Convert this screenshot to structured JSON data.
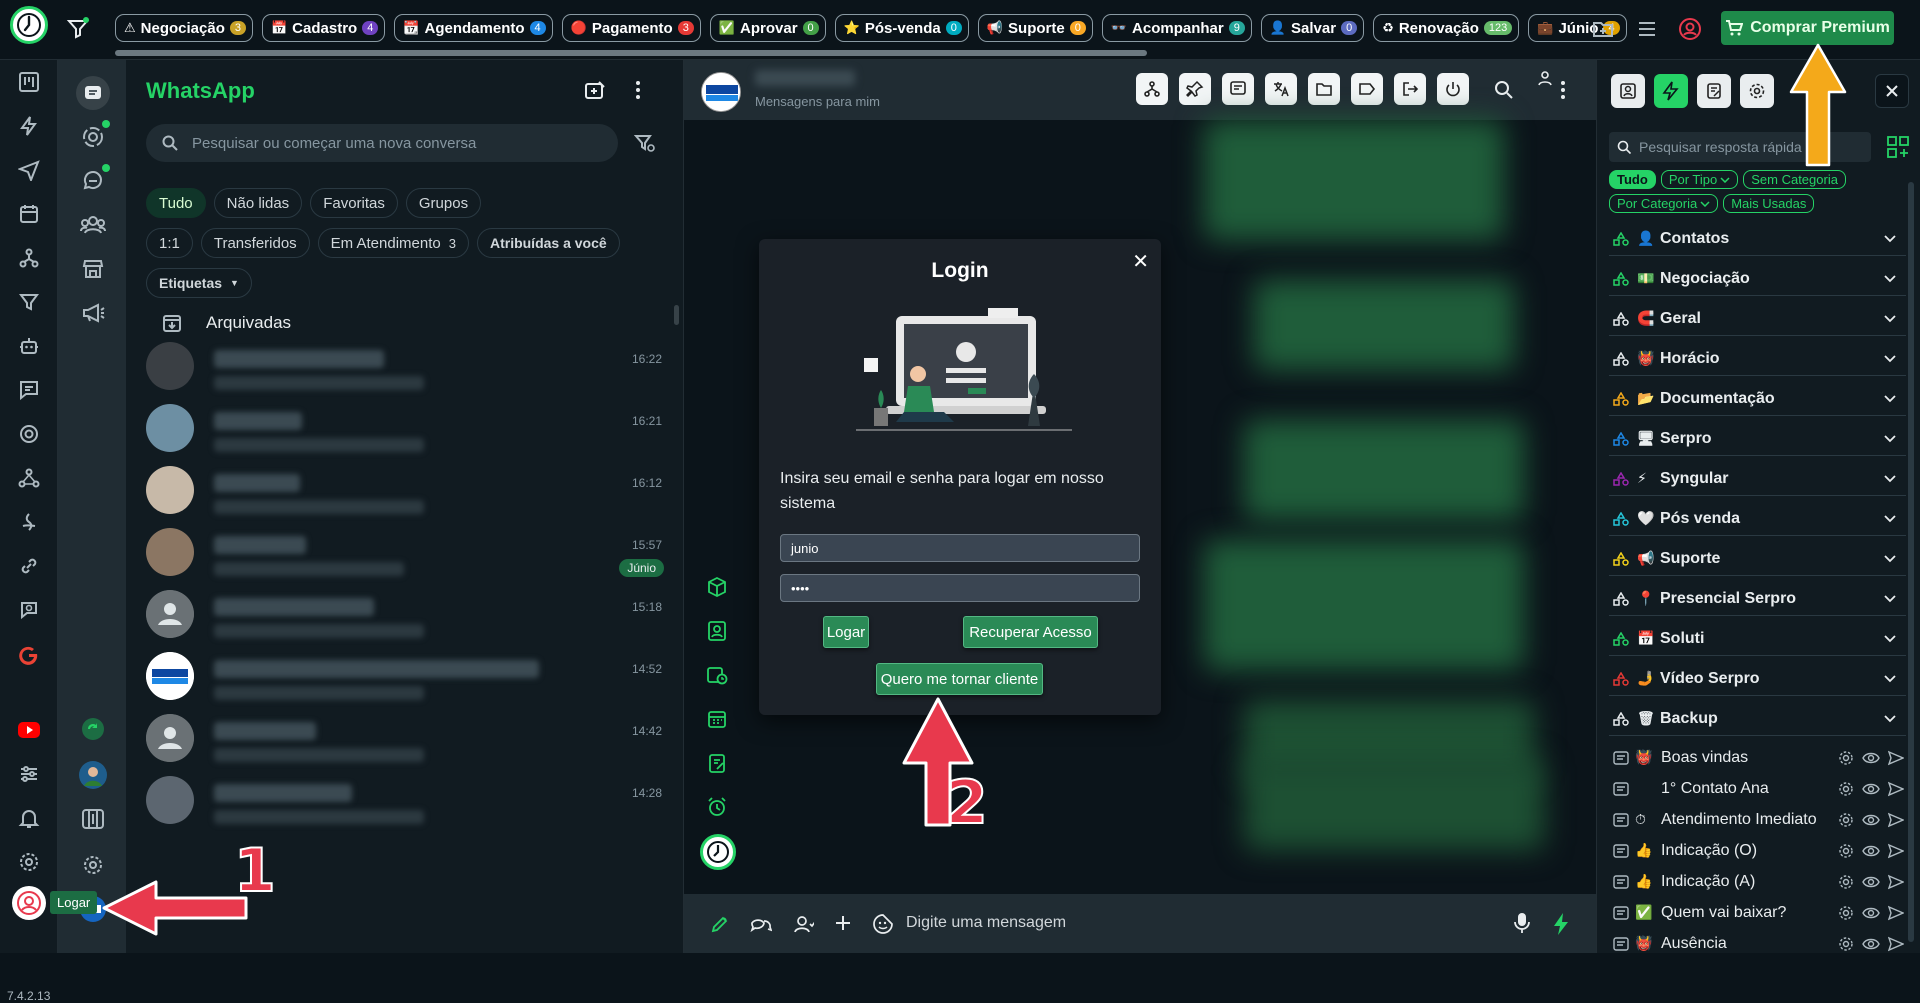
{
  "topbar": {
    "tabs": [
      {
        "icon": "⚠",
        "label": "Negociação",
        "count": "3",
        "count_color": "#c9a227"
      },
      {
        "icon": "📅",
        "label": "Cadastro",
        "count": "4",
        "count_color": "#6f42c1"
      },
      {
        "icon": "📆",
        "label": "Agendamento",
        "count": "4",
        "count_color": "#1e88e5"
      },
      {
        "icon": "🔴",
        "label": "Pagamento",
        "count": "3",
        "count_color": "#e53935"
      },
      {
        "icon": "✅",
        "label": "Aprovar",
        "count": "0",
        "count_color": "#43a047"
      },
      {
        "icon": "⭐",
        "label": "Pós-venda",
        "count": "0",
        "count_color": "#00acc1"
      },
      {
        "icon": "📢",
        "label": "Suporte",
        "count": "0",
        "count_color": "#f9a825"
      },
      {
        "icon": "👓",
        "label": "Acompanhar",
        "count": "9",
        "count_color": "#26a69a"
      },
      {
        "icon": "👤",
        "label": "Salvar",
        "count": "0",
        "count_color": "#5c6bc0"
      },
      {
        "icon": "♻",
        "label": "Renovação",
        "count": "123",
        "count_color": "#66bb6a"
      },
      {
        "icon": "💼",
        "label": "Júnio",
        "count": "4",
        "count_color": "#e0a100"
      }
    ],
    "premium_label": "Comprar Premium"
  },
  "rail": {
    "version": "7.4.2.13",
    "tooltip": "Logar"
  },
  "chatlist": {
    "title": "WhatsApp",
    "search_placeholder": "Pesquisar ou começar uma nova conversa",
    "filters_row1": [
      "Tudo",
      "Não lidas",
      "Favoritas",
      "Grupos"
    ],
    "filters_row2": [
      "1:1",
      "Transferidos",
      "Em Atendimento",
      "Atribuídas a você"
    ],
    "em_atendimento_count": "3",
    "etiquetas_label": "Etiquetas",
    "archived_label": "Arquivadas",
    "chats": [
      {
        "time": "16:22",
        "badge": ""
      },
      {
        "time": "16:21",
        "badge": ""
      },
      {
        "time": "16:12",
        "badge": ""
      },
      {
        "time": "15:57",
        "badge": "Júnio"
      },
      {
        "time": "15:18",
        "badge": ""
      },
      {
        "time": "14:52",
        "badge": ""
      },
      {
        "time": "14:42",
        "badge": ""
      },
      {
        "time": "14:28",
        "badge": ""
      }
    ]
  },
  "chat": {
    "header_subtitle": "Mensagens para mim",
    "compose_placeholder": "Digite uma mensagem"
  },
  "login_modal": {
    "title": "Login",
    "description": "Insira seu email e senha para logar em nosso sistema",
    "email_value": "junio",
    "password_value": "••••",
    "login_button": "Logar",
    "recover_button": "Recuperar Acesso",
    "become_client_button": "Quero me tornar cliente"
  },
  "rightpanel": {
    "search_placeholder": "Pesquisar resposta rápida",
    "chips_row1": [
      "Tudo",
      "Por Tipo",
      "Sem Categoria"
    ],
    "chips_row2": [
      "Por Categoria",
      "Mais Usadas"
    ],
    "categories": [
      {
        "emoji": "👤",
        "name": "Contatos",
        "color": "#25d366"
      },
      {
        "emoji": "💵",
        "name": "Negociação",
        "color": "#25d366"
      },
      {
        "emoji": "🧲",
        "name": "Geral",
        "color": "#e9edef"
      },
      {
        "emoji": "👹",
        "name": "Horácio",
        "color": "#e9edef"
      },
      {
        "emoji": "📂",
        "name": "Documentação",
        "color": "#f4a91a"
      },
      {
        "emoji": "🖥",
        "name": "Serpro",
        "color": "#1e88e5"
      },
      {
        "emoji": "⚡",
        "name": "Syngular",
        "color": "#9c27b0"
      },
      {
        "emoji": "🤍",
        "name": "Pós venda",
        "color": "#26c6da"
      },
      {
        "emoji": "📢",
        "name": "Suporte",
        "color": "#f4d21a"
      },
      {
        "emoji": "📍",
        "name": "Presencial Serpro",
        "color": "#e9edef"
      },
      {
        "emoji": "📅",
        "name": "Soluti",
        "color": "#25d366"
      },
      {
        "emoji": "🤳",
        "name": "Vídeo Serpro",
        "color": "#e53935"
      },
      {
        "emoji": "🗑",
        "name": "Backup",
        "color": "#e9edef"
      }
    ],
    "replies": [
      {
        "emoji": "👹",
        "name": "Boas vindas"
      },
      {
        "emoji": "",
        "name": "1° Contato Ana"
      },
      {
        "emoji": "⏱",
        "name": "Atendimento Imediato"
      },
      {
        "emoji": "👍",
        "name": "Indicação (O)"
      },
      {
        "emoji": "👍",
        "name": "Indicação (A)"
      },
      {
        "emoji": "✅",
        "name": "Quem vai baixar?"
      },
      {
        "emoji": "👹",
        "name": "Ausência"
      }
    ]
  },
  "annotations": {
    "number_1": "1",
    "number_2": "2",
    "arrow_color": "#e8394d",
    "premium_arrow_color": "#f4a91a"
  }
}
